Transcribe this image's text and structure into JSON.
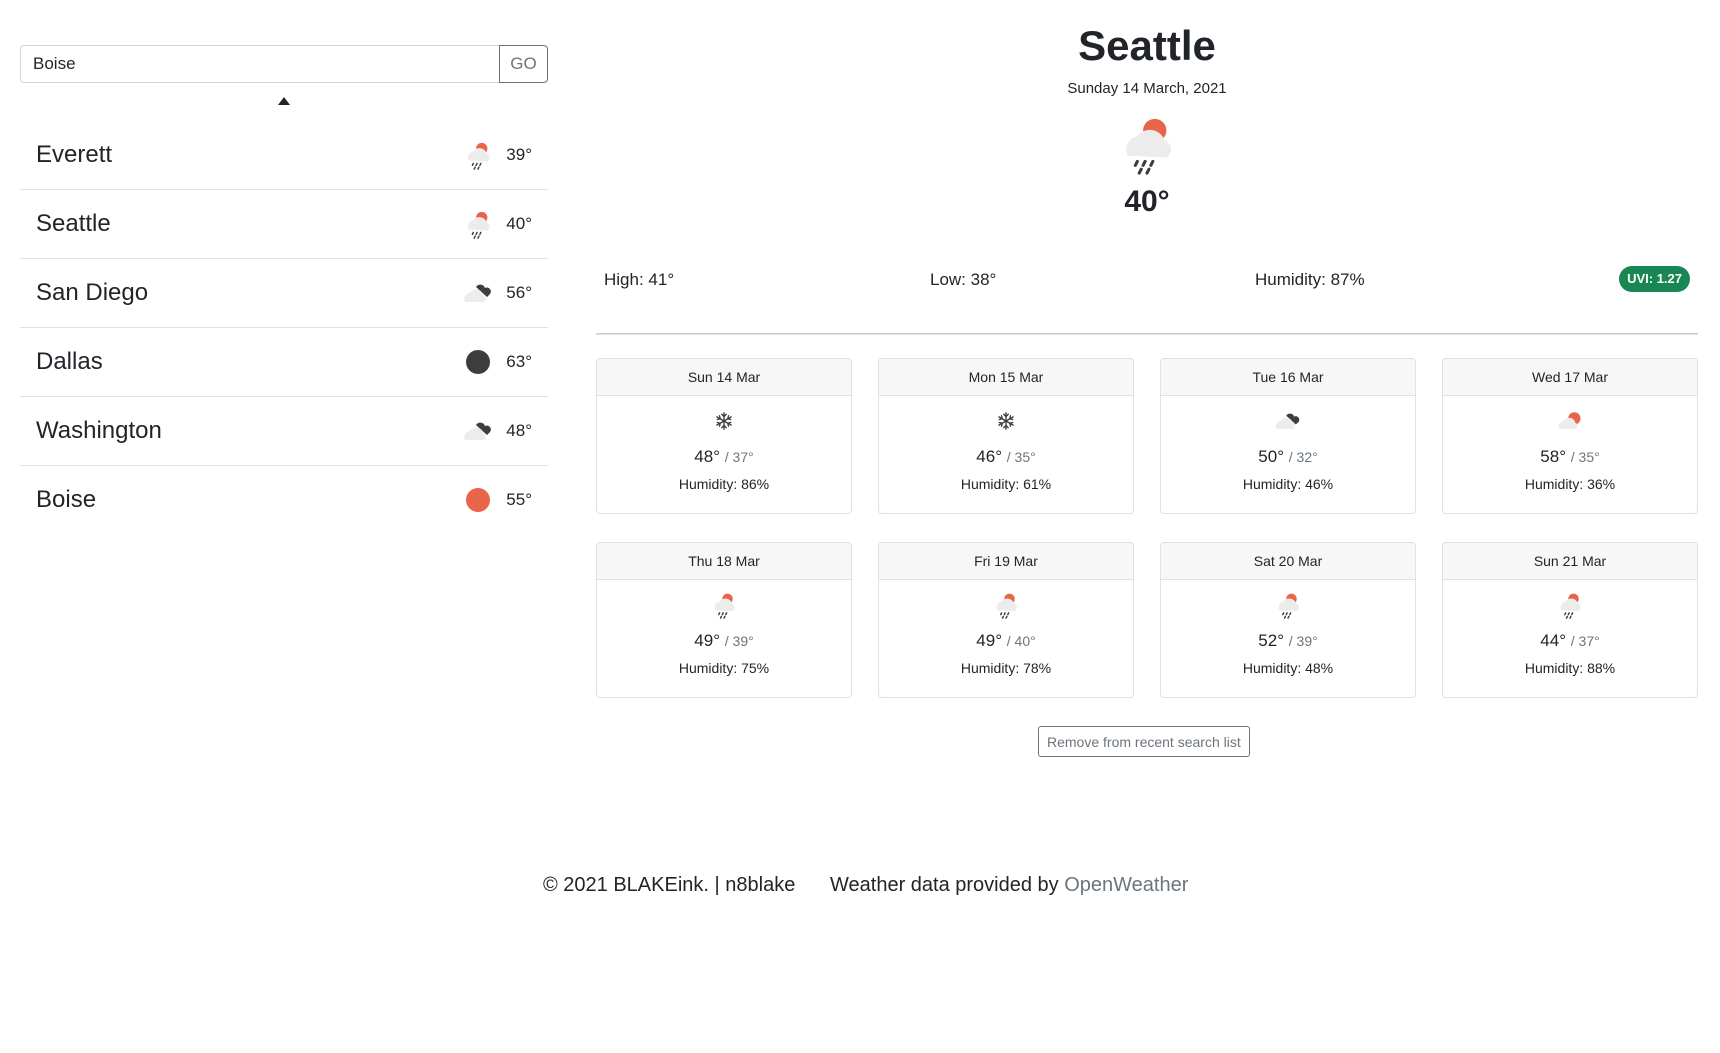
{
  "search": {
    "value": "Boise",
    "go_label": "GO"
  },
  "recent": [
    {
      "name": "Everett",
      "temp": "39°",
      "icon": "rain-cloud-icon"
    },
    {
      "name": "Seattle",
      "temp": "40°",
      "icon": "rain-cloud-icon"
    },
    {
      "name": "San Diego",
      "temp": "56°",
      "icon": "cloudy-icon"
    },
    {
      "name": "Dallas",
      "temp": "63°",
      "icon": "moon-icon"
    },
    {
      "name": "Washington",
      "temp": "48°",
      "icon": "cloudy-icon"
    },
    {
      "name": "Boise",
      "temp": "55°",
      "icon": "sun-icon"
    }
  ],
  "current": {
    "city": "Seattle",
    "date": "Sunday 14 March, 2021",
    "temp": "40°",
    "high": "High: 41°",
    "low": "Low: 38°",
    "humidity": "Humidity: 87%",
    "uvi": "UVI: 1.27"
  },
  "forecast": [
    {
      "day": "Sun 14 Mar",
      "hi": "48°",
      "lo": "/ 37°",
      "humidity": "Humidity: 86%",
      "icon": "snowflake-icon"
    },
    {
      "day": "Mon 15 Mar",
      "hi": "46°",
      "lo": "/ 35°",
      "humidity": "Humidity: 61%",
      "icon": "snowflake-icon"
    },
    {
      "day": "Tue 16 Mar",
      "hi": "50°",
      "lo": "/ 32°",
      "humidity": "Humidity: 46%",
      "icon": "cloudy-icon"
    },
    {
      "day": "Wed 17 Mar",
      "hi": "58°",
      "lo": "/ 35°",
      "humidity": "Humidity: 36%",
      "icon": "partly-cloudy-icon"
    },
    {
      "day": "Thu 18 Mar",
      "hi": "49°",
      "lo": "/ 39°",
      "humidity": "Humidity: 75%",
      "icon": "rain-cloud-icon"
    },
    {
      "day": "Fri 19 Mar",
      "hi": "49°",
      "lo": "/ 40°",
      "humidity": "Humidity: 78%",
      "icon": "rain-cloud-icon"
    },
    {
      "day": "Sat 20 Mar",
      "hi": "52°",
      "lo": "/ 39°",
      "humidity": "Humidity: 48%",
      "icon": "rain-cloud-icon"
    },
    {
      "day": "Sun 21 Mar",
      "hi": "44°",
      "lo": "/ 37°",
      "humidity": "Humidity: 88%",
      "icon": "rain-cloud-icon"
    }
  ],
  "remove_label": "Remove from recent search list",
  "footer": {
    "copyright": "© 2021 BLAKEink. | n8blake",
    "credit_prefix": "Weather data provided by ",
    "credit_link": "OpenWeather"
  },
  "colors": {
    "accent": "#e8654a",
    "uvi": "#198754",
    "dark_icon": "#3d3d3d"
  }
}
